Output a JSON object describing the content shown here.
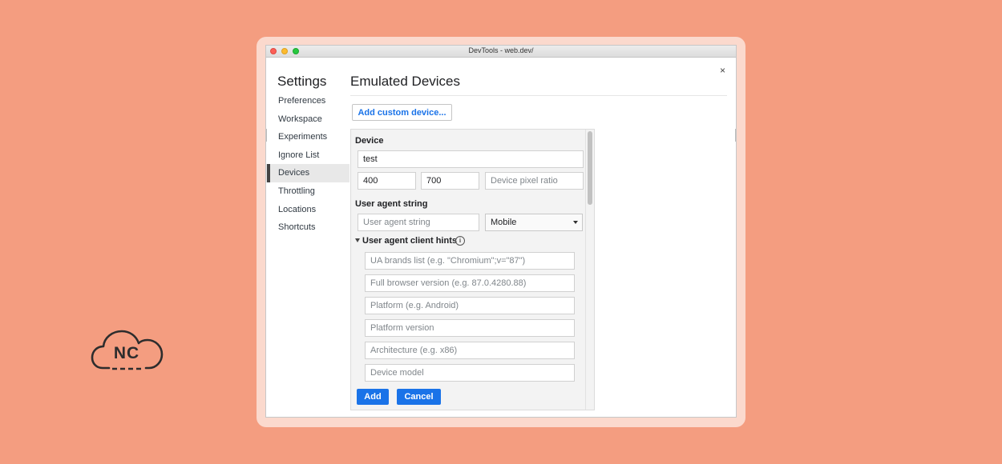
{
  "window": {
    "title": "DevTools - web.dev/"
  },
  "settings": {
    "title": "Settings",
    "nav": [
      {
        "label": "Preferences"
      },
      {
        "label": "Workspace"
      },
      {
        "label": "Experiments"
      },
      {
        "label": "Ignore List"
      },
      {
        "label": "Devices",
        "active": true
      },
      {
        "label": "Throttling"
      },
      {
        "label": "Locations"
      },
      {
        "label": "Shortcuts"
      }
    ]
  },
  "panel": {
    "title": "Emulated Devices",
    "close_label": "×",
    "add_custom_label": "Add custom device..."
  },
  "device_editor": {
    "device_label": "Device",
    "name_value": "test",
    "width_value": "400",
    "height_value": "700",
    "dpr_placeholder": "Device pixel ratio",
    "ua_label": "User agent string",
    "ua_placeholder": "User agent string",
    "ua_type_value": "Mobile",
    "hints_label": "User agent client hints",
    "info_glyph": "i",
    "hint_fields": [
      {
        "placeholder": "UA brands list (e.g. \"Chromium\";v=\"87\")"
      },
      {
        "placeholder": "Full browser version (e.g. 87.0.4280.88)"
      },
      {
        "placeholder": "Platform (e.g. Android)"
      },
      {
        "placeholder": "Platform version"
      },
      {
        "placeholder": "Architecture (e.g. x86)"
      },
      {
        "placeholder": "Device model"
      }
    ],
    "add_label": "Add",
    "cancel_label": "Cancel"
  },
  "brand": {
    "logo_text": "NC"
  },
  "colors": {
    "background": "#f49d80",
    "accent": "#1a73e8"
  }
}
